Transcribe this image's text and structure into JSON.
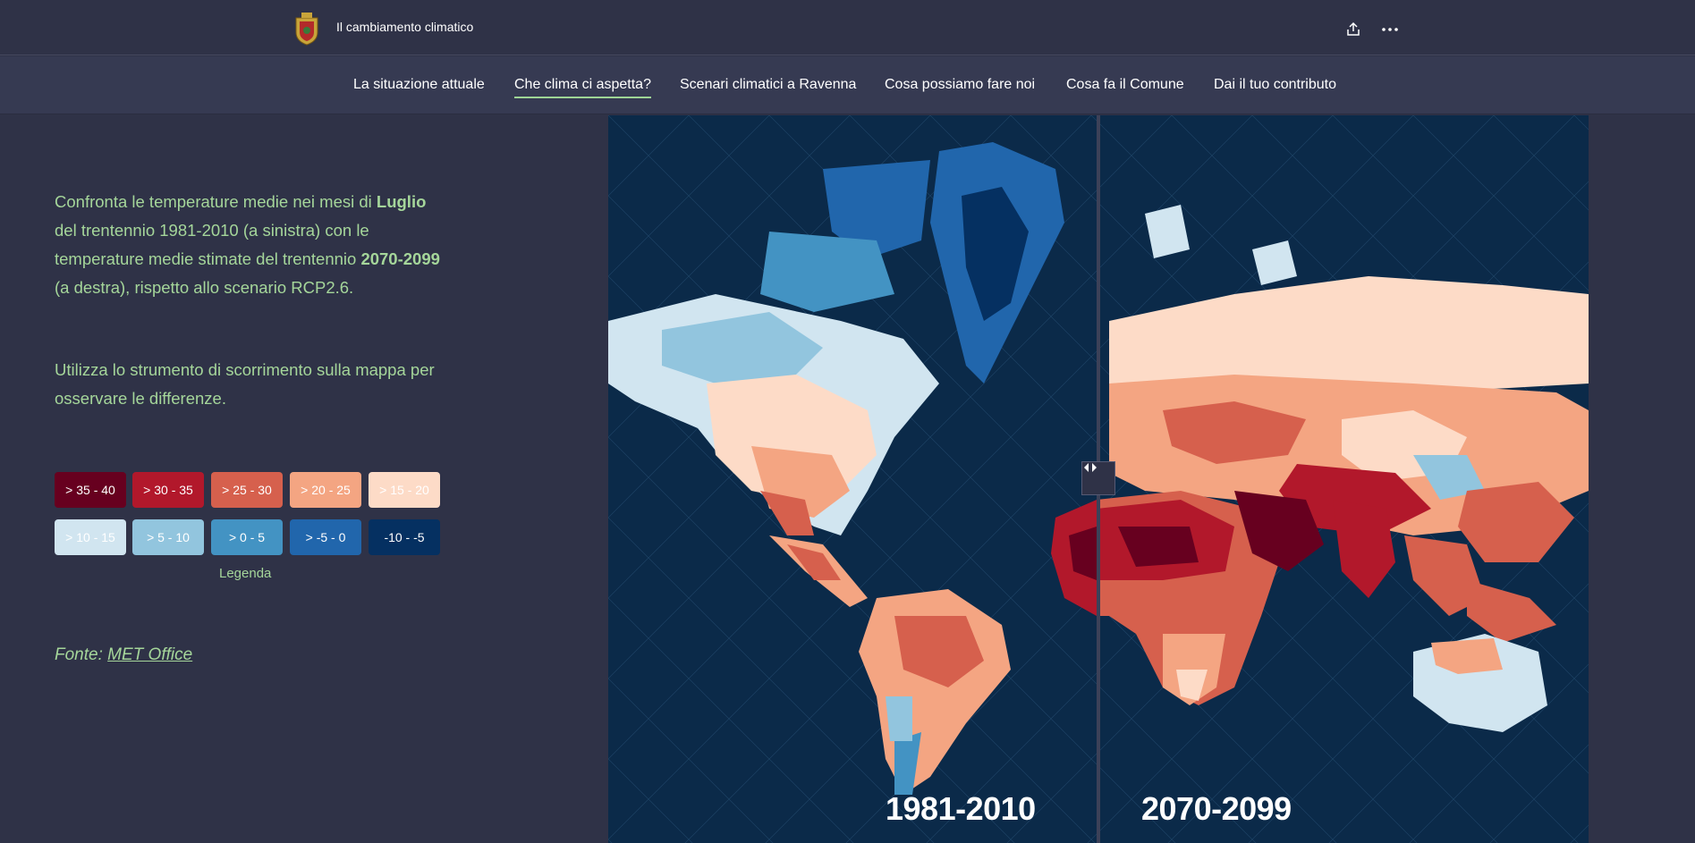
{
  "header": {
    "title": "Il cambiamento climatico"
  },
  "nav": {
    "items": [
      {
        "label": "La situazione attuale"
      },
      {
        "label": "Che clima ci aspetta?"
      },
      {
        "label": "Scenari climatici a Ravenna"
      },
      {
        "label": "Cosa possiamo fare noi"
      },
      {
        "label": "Cosa fa il Comune"
      },
      {
        "label": "Dai il tuo contributo"
      }
    ],
    "active": "Che clima ci aspetta?"
  },
  "content": {
    "p1_a": "Confronta le temperature medie nei mesi di ",
    "p1_b": "Luglio",
    "p1_c": " del trentennio 1981-2010 (a sinistra) con le temperature medie stimate del trentennio ",
    "p1_d": "2070-2099",
    "p1_e": " (a destra), rispetto allo scenario RCP2.6.",
    "p2": "Utilizza lo strumento di scorrimento sulla mappa per osservare le differenze.",
    "source_label": "Fonte: ",
    "source_link": "MET Office"
  },
  "legend": {
    "title": "Legenda",
    "items": [
      {
        "label": "> 35 - 40",
        "color": "#67001f"
      },
      {
        "label": "> 30 - 35",
        "color": "#b2182b"
      },
      {
        "label": "> 25 - 30",
        "color": "#d6604d"
      },
      {
        "label": "> 20 - 25",
        "color": "#f4a582"
      },
      {
        "label": "> 15 - 20",
        "color": "#fddbc7"
      },
      {
        "label": "> 10 - 15",
        "color": "#d1e5f0"
      },
      {
        "label": "> 5 - 10",
        "color": "#92c5de"
      },
      {
        "label": "> 0 - 5",
        "color": "#4393c3"
      },
      {
        "label": "> -5 - 0",
        "color": "#2166ac"
      },
      {
        "label": "-10 - -5",
        "color": "#053061"
      }
    ]
  },
  "map": {
    "left_period": "1981-2010",
    "right_period": "2070-2099"
  }
}
